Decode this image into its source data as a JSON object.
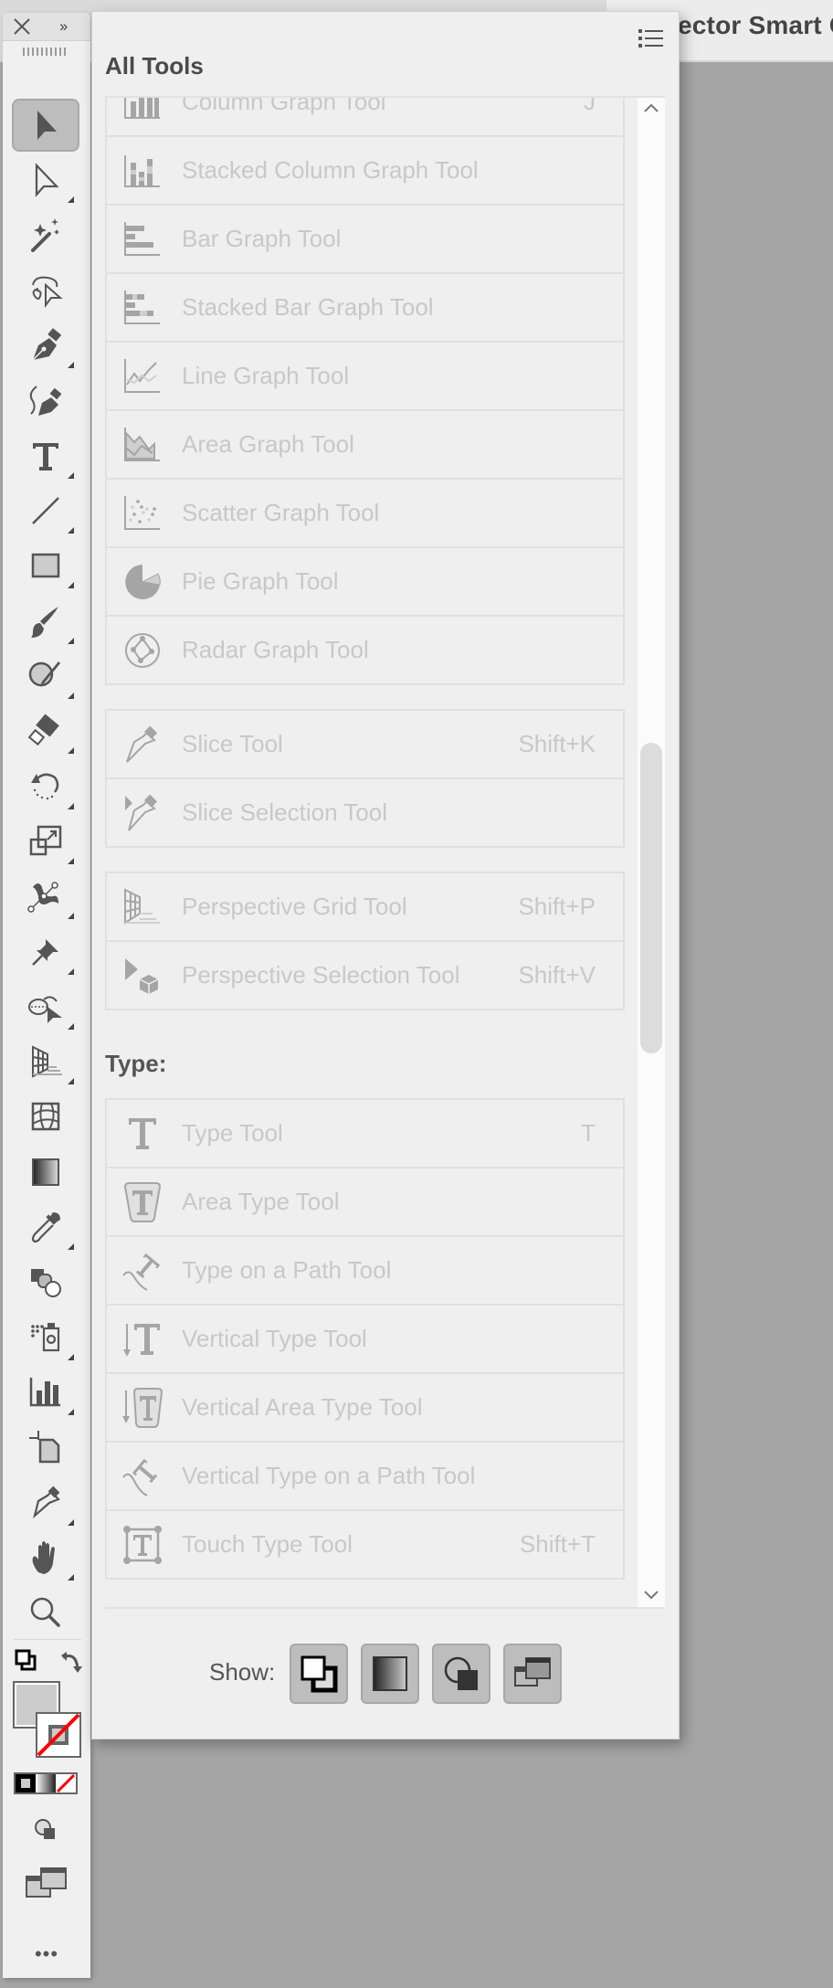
{
  "window": {
    "document_title_fragment": "ector Smart O"
  },
  "toolbar": {
    "close_label": "×",
    "expand_label": "››",
    "tools": [
      {
        "name": "selection-tool",
        "selected": true,
        "has_flyout": false
      },
      {
        "name": "direct-selection-tool",
        "selected": false,
        "has_flyout": true
      },
      {
        "name": "magic-wand-tool",
        "selected": false,
        "has_flyout": false
      },
      {
        "name": "lasso-tool",
        "selected": false,
        "has_flyout": false
      },
      {
        "name": "pen-tool",
        "selected": false,
        "has_flyout": true
      },
      {
        "name": "curvature-tool",
        "selected": false,
        "has_flyout": false
      },
      {
        "name": "type-tool",
        "selected": false,
        "has_flyout": true
      },
      {
        "name": "line-segment-tool",
        "selected": false,
        "has_flyout": true
      },
      {
        "name": "rectangle-tool",
        "selected": false,
        "has_flyout": true
      },
      {
        "name": "paintbrush-tool",
        "selected": false,
        "has_flyout": true
      },
      {
        "name": "shaper-tool",
        "selected": false,
        "has_flyout": true
      },
      {
        "name": "eraser-tool",
        "selected": false,
        "has_flyout": true
      },
      {
        "name": "rotate-tool",
        "selected": false,
        "has_flyout": true
      },
      {
        "name": "scale-tool",
        "selected": false,
        "has_flyout": true
      },
      {
        "name": "puppet-warp-tool",
        "selected": false,
        "has_flyout": true
      },
      {
        "name": "pin-tool",
        "selected": false,
        "has_flyout": true
      },
      {
        "name": "shape-builder-tool",
        "selected": false,
        "has_flyout": true
      },
      {
        "name": "perspective-grid-tool",
        "selected": false,
        "has_flyout": true
      },
      {
        "name": "mesh-tool",
        "selected": false,
        "has_flyout": false
      },
      {
        "name": "gradient-tool",
        "selected": false,
        "has_flyout": false
      },
      {
        "name": "eyedropper-tool",
        "selected": false,
        "has_flyout": true
      },
      {
        "name": "blend-tool",
        "selected": false,
        "has_flyout": false
      },
      {
        "name": "symbol-sprayer-tool",
        "selected": false,
        "has_flyout": true
      },
      {
        "name": "column-graph-tool",
        "selected": false,
        "has_flyout": true
      },
      {
        "name": "artboard-tool",
        "selected": false,
        "has_flyout": false
      },
      {
        "name": "slice-tool",
        "selected": false,
        "has_flyout": true
      },
      {
        "name": "hand-tool",
        "selected": false,
        "has_flyout": true
      },
      {
        "name": "zoom-tool",
        "selected": false,
        "has_flyout": false
      }
    ],
    "more_label": "•••",
    "colors": {
      "fill": "#cccccc",
      "stroke": "none",
      "none_slash": "#ff0000"
    }
  },
  "panel": {
    "title": "All Tools",
    "groups": [
      {
        "items": [
          {
            "label": "Column Graph Tool",
            "shortcut": "J",
            "icon": "column-graph-icon"
          },
          {
            "label": "Stacked Column Graph Tool",
            "shortcut": "",
            "icon": "stacked-column-graph-icon"
          },
          {
            "label": "Bar Graph Tool",
            "shortcut": "",
            "icon": "bar-graph-icon"
          },
          {
            "label": "Stacked Bar Graph Tool",
            "shortcut": "",
            "icon": "stacked-bar-graph-icon"
          },
          {
            "label": "Line Graph Tool",
            "shortcut": "",
            "icon": "line-graph-icon"
          },
          {
            "label": "Area Graph Tool",
            "shortcut": "",
            "icon": "area-graph-icon"
          },
          {
            "label": "Scatter Graph Tool",
            "shortcut": "",
            "icon": "scatter-graph-icon"
          },
          {
            "label": "Pie Graph Tool",
            "shortcut": "",
            "icon": "pie-graph-icon"
          },
          {
            "label": "Radar Graph Tool",
            "shortcut": "",
            "icon": "radar-graph-icon"
          }
        ]
      },
      {
        "items": [
          {
            "label": "Slice Tool",
            "shortcut": "Shift+K",
            "icon": "slice-icon"
          },
          {
            "label": "Slice Selection Tool",
            "shortcut": "",
            "icon": "slice-selection-icon"
          }
        ]
      },
      {
        "items": [
          {
            "label": "Perspective Grid Tool",
            "shortcut": "Shift+P",
            "icon": "perspective-grid-icon"
          },
          {
            "label": "Perspective Selection Tool",
            "shortcut": "Shift+V",
            "icon": "perspective-selection-icon"
          }
        ]
      }
    ],
    "type_section": {
      "label": "Type:",
      "items": [
        {
          "label": "Type Tool",
          "shortcut": "T",
          "icon": "type-icon"
        },
        {
          "label": "Area Type Tool",
          "shortcut": "",
          "icon": "area-type-icon"
        },
        {
          "label": "Type on a Path Tool",
          "shortcut": "",
          "icon": "type-on-path-icon"
        },
        {
          "label": "Vertical Type Tool",
          "shortcut": "",
          "icon": "vertical-type-icon"
        },
        {
          "label": "Vertical Area Type Tool",
          "shortcut": "",
          "icon": "vertical-area-type-icon"
        },
        {
          "label": "Vertical Type on a Path Tool",
          "shortcut": "",
          "icon": "vertical-type-on-path-icon"
        },
        {
          "label": "Touch Type Tool",
          "shortcut": "Shift+T",
          "icon": "touch-type-icon"
        }
      ]
    },
    "show": {
      "label": "Show:",
      "buttons": [
        {
          "name": "show-fill-stroke-button"
        },
        {
          "name": "show-gradient-button"
        },
        {
          "name": "show-draw-modes-button"
        },
        {
          "name": "show-screen-modes-button"
        }
      ]
    },
    "scroll_position": 0.42
  }
}
